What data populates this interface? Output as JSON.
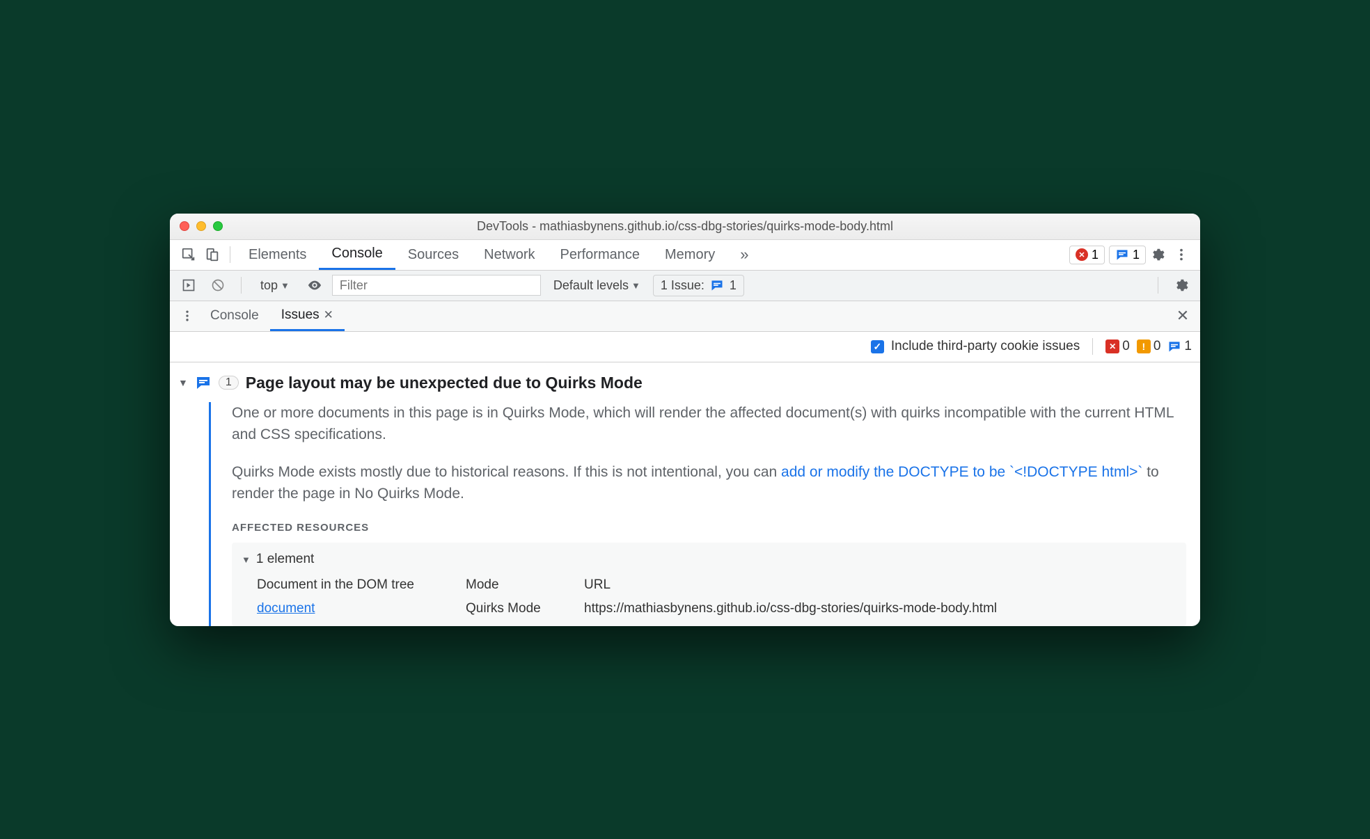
{
  "window": {
    "title": "DevTools - mathiasbynens.github.io/css-dbg-stories/quirks-mode-body.html"
  },
  "main_tabs": {
    "items": [
      "Elements",
      "Console",
      "Sources",
      "Network",
      "Performance",
      "Memory"
    ],
    "active_index": 1,
    "overflow_glyph": "»",
    "error_count": "1",
    "issue_count": "1"
  },
  "console_toolbar": {
    "context": "top",
    "filter_placeholder": "Filter",
    "levels_label": "Default levels",
    "issue_label": "1 Issue:",
    "issue_count": "1"
  },
  "drawer": {
    "tabs": [
      "Console",
      "Issues"
    ],
    "active_index": 1
  },
  "issues_filter": {
    "checkbox_label": "Include third-party cookie issues",
    "err_count": "0",
    "warn_count": "0",
    "info_count": "1"
  },
  "issue": {
    "count": "1",
    "title": "Page layout may be unexpected due to Quirks Mode",
    "p1": "One or more documents in this page is in Quirks Mode, which will render the affected document(s) with quirks incompatible with the current HTML and CSS specifications.",
    "p2a": "Quirks Mode exists mostly due to historical reasons. If this is not intentional, you can ",
    "p2_link": "add or modify the DOCTYPE to be `<!DOCTYPE html>`",
    "p2b": " to render the page in No Quirks Mode.",
    "affected_label": "AFFECTED RESOURCES",
    "affected_summary": "1 element",
    "cols": {
      "c1": "Document in the DOM tree",
      "c2": "Mode",
      "c3": "URL"
    },
    "row": {
      "doc": "document",
      "mode": "Quirks Mode",
      "url": "https://mathiasbynens.github.io/css-dbg-stories/quirks-mode-body.html"
    }
  }
}
